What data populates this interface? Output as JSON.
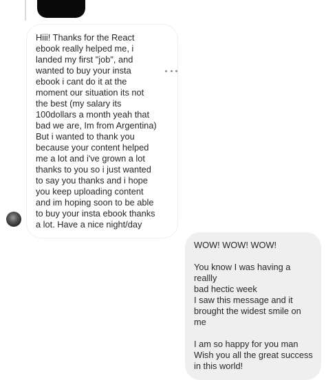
{
  "thread": {
    "incoming_message": {
      "text": "Hiii! Thanks for the React\nebook really helped me, i\nlanded my first \"job\", and\nwanted to buy your insta\nebook i cant do it at the\nmoment our situation its not\nthe best (my salary its\n100dollars a month yeah that\nbad we are, Im from Argentina)\nBut i wanted to thank you\nbecause your content helped\nme a lot and i've grown a lot\nthanks to you so i just wanted\nto say you thanks and i hope\nyou keep uploading content\nand im hoping soon to be able\nto buy your insta ebook thanks\na lot. Have a nice night/day"
    },
    "outgoing_message": {
      "text": "WOW! WOW! WOW!\n\nYou know I was having a reallly\nbad hectic week\nI saw this message and it\nbrought the widest smile on\nme\n\nI am so happy for you man\nWish you all the great success\nin this world!"
    },
    "icons": {
      "more": "more-options-icon",
      "avatar": "sender-avatar"
    },
    "colors": {
      "incoming_bubble_border": "#efefef",
      "outgoing_bubble_bg": "#efefef",
      "text": "#262626",
      "muted": "#8e8e8e"
    }
  }
}
